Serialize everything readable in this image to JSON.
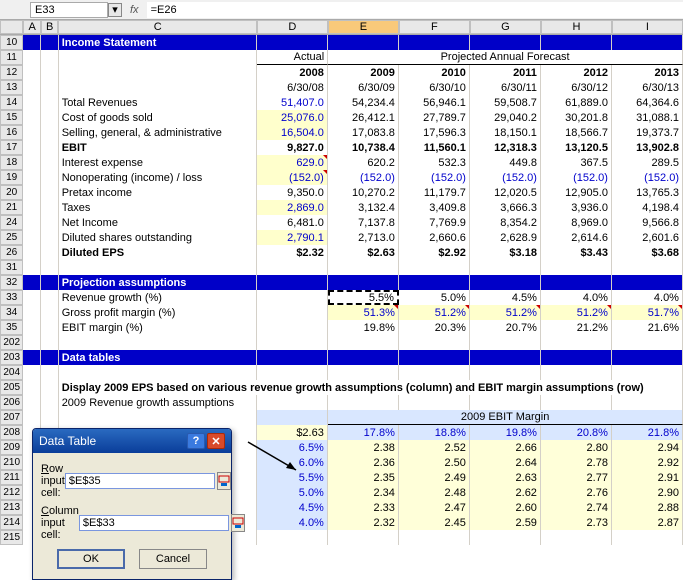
{
  "formula_bar": {
    "cell_ref": "E33",
    "fx": "fx",
    "formula": "=E26"
  },
  "col_headers": [
    "A",
    "B",
    "C",
    "D",
    "E",
    "F",
    "G",
    "H",
    "I"
  ],
  "row_numbers": [
    10,
    11,
    12,
    13,
    14,
    15,
    16,
    17,
    18,
    19,
    20,
    21,
    24,
    25,
    26,
    31,
    32,
    33,
    34,
    35,
    202,
    203,
    204,
    205,
    206,
    207,
    208,
    209,
    210,
    211,
    212,
    213,
    214,
    215
  ],
  "sections": {
    "income_title": "Income Statement",
    "actual": "Actual",
    "forecast": "Projected Annual Forecast",
    "years": [
      "2008",
      "2009",
      "2010",
      "2011",
      "2012",
      "2013"
    ],
    "dates": [
      "6/30/08",
      "6/30/09",
      "6/30/10",
      "6/30/11",
      "6/30/12",
      "6/30/13"
    ],
    "line_items": [
      {
        "label": "Total Revenues",
        "vals": [
          "51,407.0",
          "54,234.4",
          "56,946.1",
          "59,508.7",
          "61,889.0",
          "64,364.6"
        ],
        "blue0": true
      },
      {
        "label": "Cost of goods sold",
        "vals": [
          "25,076.0",
          "26,412.1",
          "27,789.7",
          "29,040.2",
          "30,201.8",
          "31,088.1"
        ],
        "blue0": true,
        "yel": true
      },
      {
        "label": "Selling, general, & administrative",
        "vals": [
          "16,504.0",
          "17,083.8",
          "17,596.3",
          "18,150.1",
          "18,566.7",
          "19,373.7"
        ],
        "blue0": true,
        "yel": true
      },
      {
        "label": "EBIT",
        "vals": [
          "9,827.0",
          "10,738.4",
          "11,560.1",
          "12,318.3",
          "13,120.5",
          "13,902.8"
        ],
        "bold": true
      },
      {
        "label": "Interest expense",
        "vals": [
          "629.0",
          "620.2",
          "532.3",
          "449.8",
          "367.5",
          "289.5"
        ],
        "blue0": true,
        "yel": true,
        "tri": true
      },
      {
        "label": "Nonoperating (income) / loss",
        "vals": [
          "(152.0)",
          "(152.0)",
          "(152.0)",
          "(152.0)",
          "(152.0)",
          "(152.0)"
        ],
        "blue0": true,
        "blueAll": true,
        "yel": true,
        "tri": true
      },
      {
        "label": "Pretax income",
        "vals": [
          "9,350.0",
          "10,270.2",
          "11,179.7",
          "12,020.5",
          "12,905.0",
          "13,765.3"
        ]
      },
      {
        "label": "Taxes",
        "vals": [
          "2,869.0",
          "3,132.4",
          "3,409.8",
          "3,666.3",
          "3,936.0",
          "4,198.4"
        ],
        "blue0": true,
        "yel": true
      },
      {
        "label": "Net Income",
        "vals": [
          "6,481.0",
          "7,137.8",
          "7,769.9",
          "8,354.2",
          "8,969.0",
          "9,566.8"
        ]
      },
      {
        "label": "Diluted shares outstanding",
        "vals": [
          "2,790.1",
          "2,713.0",
          "2,660.6",
          "2,628.9",
          "2,614.6",
          "2,601.6"
        ],
        "blue0": true,
        "yel": true
      },
      {
        "label": "Diluted EPS",
        "vals": [
          "$2.32",
          "$2.63",
          "$2.92",
          "$3.18",
          "$3.43",
          "$3.68"
        ],
        "bold": true
      }
    ],
    "proj_title": "Projection assumptions",
    "proj_rows": [
      {
        "label": "Revenue growth (%)",
        "vals": [
          "",
          "5.5%",
          "5.0%",
          "4.5%",
          "4.0%",
          "4.0%"
        ],
        "march": 1
      },
      {
        "label": "Gross profit margin (%)",
        "vals": [
          "",
          "51.3%",
          "51.2%",
          "51.2%",
          "51.2%",
          "51.7%"
        ],
        "blue": true,
        "yel": true,
        "tri": true
      },
      {
        "label": "EBIT margin (%)",
        "vals": [
          "",
          "19.8%",
          "20.3%",
          "20.7%",
          "21.2%",
          "21.6%"
        ]
      }
    ],
    "data_tables_title": "Data tables",
    "display_label": "Display 2009 EPS based on various revenue growth assumptions (column) and EBIT margin assumptions (row)",
    "rev_assump_label": "2009 Revenue  growth assumptions",
    "ebit_margin_hdr": "2009 EBIT Margin"
  },
  "chart_data": {
    "type": "table",
    "title": "2009 EBIT Margin",
    "header_val": "$2.63",
    "col_pcts": [
      "17.8%",
      "18.8%",
      "19.8%",
      "20.8%",
      "21.8%"
    ],
    "row_pcts": [
      "6.5%",
      "6.0%",
      "5.5%",
      "5.0%",
      "4.5%",
      "4.0%"
    ],
    "values": [
      [
        "2.38",
        "2.52",
        "2.66",
        "2.80",
        "2.94"
      ],
      [
        "2.36",
        "2.50",
        "2.64",
        "2.78",
        "2.92"
      ],
      [
        "2.35",
        "2.49",
        "2.63",
        "2.77",
        "2.91"
      ],
      [
        "2.34",
        "2.48",
        "2.62",
        "2.76",
        "2.90"
      ],
      [
        "2.33",
        "2.47",
        "2.60",
        "2.74",
        "2.88"
      ],
      [
        "2.32",
        "2.45",
        "2.59",
        "2.73",
        "2.87"
      ]
    ]
  },
  "dialog": {
    "title": "Data Table",
    "row_label": "Row input cell:",
    "row_key": "R",
    "col_label": "Column input cell:",
    "col_key": "C",
    "row_val": "$E$35",
    "col_val": "$E$33",
    "ok": "OK",
    "cancel": "Cancel"
  }
}
